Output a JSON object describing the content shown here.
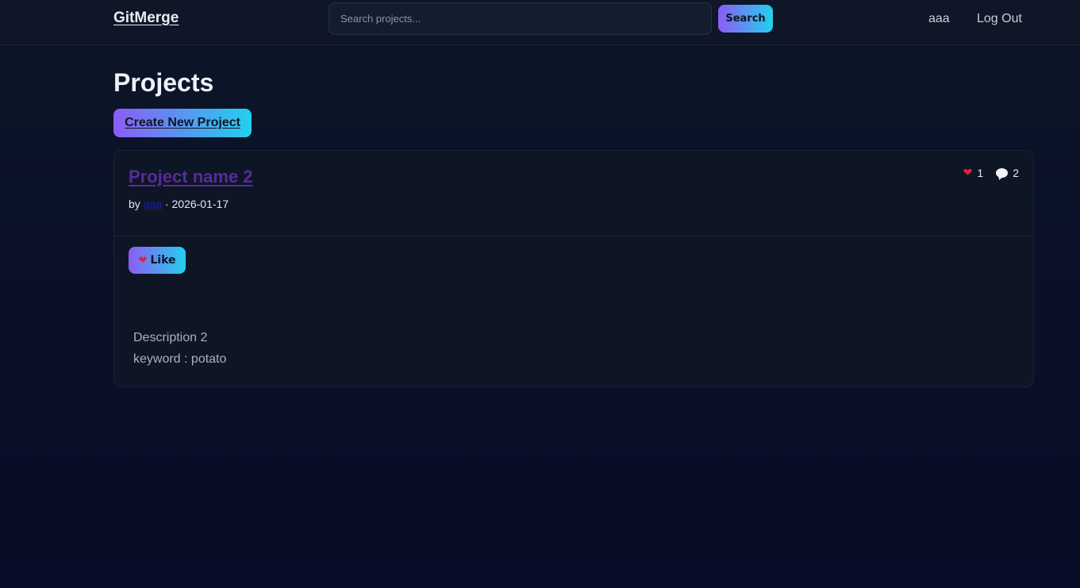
{
  "navbar": {
    "brand": "GitMerge",
    "search_placeholder": "Search projects...",
    "search_label": "Search",
    "user": "aaa",
    "logout": "Log Out"
  },
  "main": {
    "title": "Projects",
    "create_label": "Create New Project",
    "projects": [
      {
        "title": "Project name 2",
        "by_prefix": "by",
        "author": "aaa",
        "separator": "·",
        "date": "2026-01-17",
        "likes": "1",
        "comments": "2",
        "like_label": "Like",
        "description": "Description 2",
        "keyword": "keyword : potato"
      }
    ]
  },
  "icons": {
    "heart": "❤",
    "comment": "speech-bubble"
  },
  "colors": {
    "accent_start": "#8c5cf5",
    "accent_end": "#22d0ee",
    "background": "#0a1128"
  }
}
